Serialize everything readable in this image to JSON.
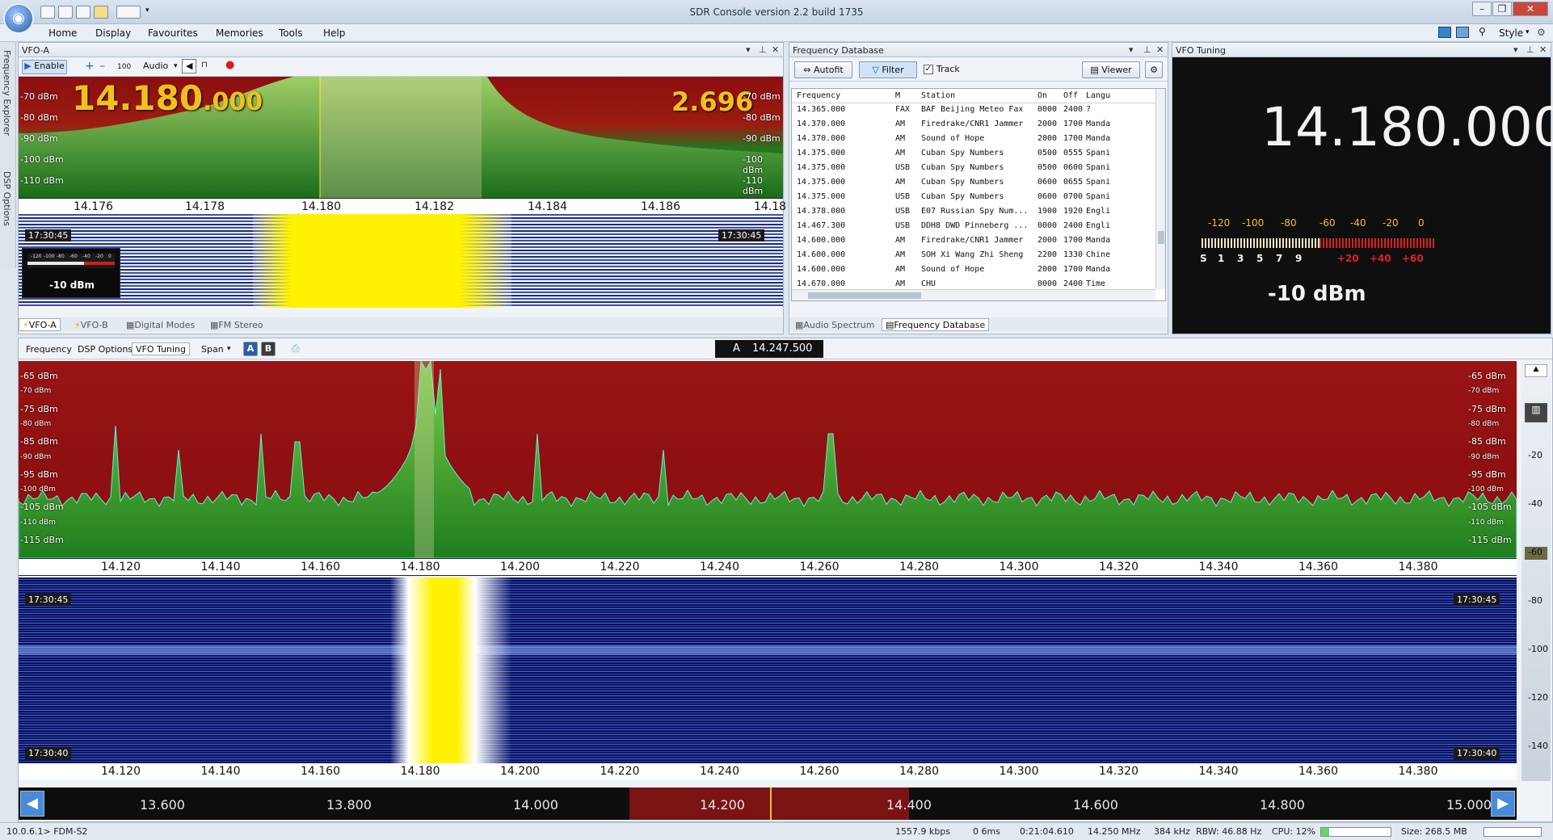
{
  "app": {
    "title": "SDR Console version 2.2 build 1735"
  },
  "ribbon": {
    "tabs": [
      "Home",
      "Display",
      "Favourites",
      "Memories",
      "Tools",
      "Help"
    ],
    "style_label": "Style"
  },
  "vfo_pane": {
    "title": "VFO-A",
    "toolbar": {
      "enable": "Enable",
      "step": "100",
      "audio": "Audio"
    },
    "freq_main": "14.180",
    "freq_sub": ".000",
    "freq_right": "2.696",
    "dbm_left": [
      "-70 dBm",
      "-80 dBm",
      "-90 dBm",
      "-100 dBm",
      "-110 dBm"
    ],
    "dbm_right": [
      "-70 dBm",
      "-80 dBm",
      "-90 dBm",
      "-100 dBm",
      "-110 dBm"
    ],
    "scale": [
      "14.176",
      "14.178",
      "14.180",
      "14.182",
      "14.184",
      "14.186",
      "14.18"
    ],
    "time": "17:30:45",
    "smeter_value": "-10 dBm",
    "smeter_ticks": [
      "-120",
      "-100",
      "-80",
      "-60",
      "-40",
      "-20",
      "0"
    ],
    "tabs": [
      "VFO-A",
      "VFO-B",
      "Digital Modes",
      "FM Stereo"
    ]
  },
  "freqdb": {
    "title": "Frequency Database",
    "buttons": {
      "autofit": "Autofit",
      "filter": "Filter",
      "track": "Track",
      "viewer": "Viewer"
    },
    "columns": [
      "Frequency",
      "M",
      "Station",
      "On",
      "Off",
      "Langu"
    ],
    "rows": [
      [
        "14.365.000",
        "FAX",
        "BAF Beijing Meteo Fax",
        "0000",
        "2400",
        "?"
      ],
      [
        "14.370.000",
        "AM",
        "Firedrake/CNR1 Jammer",
        "2000",
        "1700",
        "Manda"
      ],
      [
        "14.370.000",
        "AM",
        "Sound of Hope",
        "2000",
        "1700",
        "Manda"
      ],
      [
        "14.375.000",
        "AM",
        "Cuban Spy Numbers",
        "0500",
        "0555",
        "Spani"
      ],
      [
        "14.375.000",
        "USB",
        "Cuban Spy Numbers",
        "0500",
        "0600",
        "Spani"
      ],
      [
        "14.375.000",
        "AM",
        "Cuban Spy Numbers",
        "0600",
        "0655",
        "Spani"
      ],
      [
        "14.375.000",
        "USB",
        "Cuban Spy Numbers",
        "0600",
        "0700",
        "Spani"
      ],
      [
        "14.378.000",
        "USB",
        "E07 Russian Spy Num...",
        "1900",
        "1920",
        "Engli"
      ],
      [
        "14.467.300",
        "USB",
        "DDH8 DWD Pinneberg ...",
        "0000",
        "2400",
        "Engli"
      ],
      [
        "14.600.000",
        "AM",
        "Firedrake/CNR1 Jammer",
        "2000",
        "1700",
        "Manda"
      ],
      [
        "14.600.000",
        "AM",
        "SOH Xi Wang Zhi Sheng",
        "2200",
        "1330",
        "Chine"
      ],
      [
        "14.600.000",
        "AM",
        "Sound of Hope",
        "2000",
        "1700",
        "Manda"
      ],
      [
        "14.670.000",
        "AM",
        "CHU",
        "0000",
        "2400",
        "Time"
      ]
    ],
    "tabs": [
      "Audio Spectrum",
      "Frequency Database"
    ]
  },
  "vfotuning": {
    "title": "VFO Tuning",
    "freq": "14.180.000",
    "meter_ticks": [
      "-120",
      "-100",
      "-80",
      "-60",
      "-40",
      "-20",
      "0"
    ],
    "s_units": [
      "S",
      "1",
      "3",
      "5",
      "7",
      "9"
    ],
    "plus_units": [
      "+20",
      "+40",
      "+60"
    ],
    "dbm": "-10 dBm"
  },
  "main": {
    "tabs": [
      "Frequency",
      "DSP Options",
      "VFO Tuning"
    ],
    "span": "Span",
    "ab": [
      "A",
      "B"
    ],
    "center_label": "A",
    "center_freq": "14.247.500",
    "dbm_left": [
      "-65 dBm",
      "-70 dBm",
      "-75 dBm",
      "-80 dBm",
      "-85 dBm",
      "-90 dBm",
      "-95 dBm",
      "-100 dBm",
      "-105 dBm",
      "-110 dBm",
      "-115 dBm"
    ],
    "dbm_right": [
      "-65 dBm",
      "-70 dBm",
      "-75 dBm",
      "-80 dBm",
      "-85 dBm",
      "-90 dBm",
      "-95 dBm",
      "-100 dBm",
      "-105 dBm",
      "-110 dBm",
      "-115 dBm"
    ],
    "scale": [
      "14.120",
      "14.140",
      "14.160",
      "14.180",
      "14.200",
      "14.220",
      "14.240",
      "14.260",
      "14.280",
      "14.300",
      "14.320",
      "14.340",
      "14.360",
      "14.380"
    ],
    "time_top": "17:30:45",
    "time_bottom": "17:30:40",
    "band": [
      "13.600",
      "13.800",
      "14.000",
      "14.200",
      "14.400",
      "14.600",
      "14.800",
      "15.000"
    ],
    "side_scale": [
      "-20",
      "-40",
      "-60",
      "-80",
      "-100",
      "-120",
      "-140"
    ]
  },
  "side": {
    "freq_explorer": "Frequency Explorer",
    "dsp_options": "DSP Options"
  },
  "status": {
    "ip": "10.0.6.1> FDM-S2",
    "rate": "1557.9 kbps",
    "drops": "0  6ms",
    "time": "0:21:04.610",
    "freq": "14.250 MHz",
    "bw": "384 kHz",
    "rbw": "RBW: 46.88 Hz",
    "cpu": "CPU: 12%",
    "size": "Size: 268.5 MB"
  }
}
